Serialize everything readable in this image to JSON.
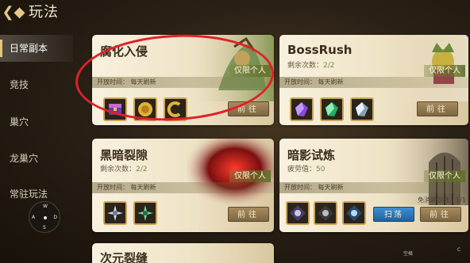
{
  "header": {
    "title": "玩法"
  },
  "sidebar": {
    "items": [
      {
        "label": "日常副本"
      },
      {
        "label": "竞技"
      },
      {
        "label": "巢穴"
      },
      {
        "label": "龙巢穴"
      },
      {
        "label": "常驻玩法"
      }
    ]
  },
  "compass": {
    "n": "W",
    "w": "A",
    "e": "D",
    "s": "S"
  },
  "cards": {
    "corruption": {
      "title": "腐化入侵",
      "time_label": "开放时间：",
      "time_value": "每天刷新",
      "personal": "仅限个人",
      "button": "前往"
    },
    "bossrush": {
      "title": "BossRush",
      "remaining_label": "剩余次数：",
      "remaining_value": "2/2",
      "time_label": "开放时间：",
      "time_value": "每天刷新",
      "personal": "仅限个人",
      "button": "前往"
    },
    "darkrift": {
      "title": "黑暗裂隙",
      "remaining_label": "剩余次数：",
      "remaining_value": "2/2",
      "time_label": "开放时间：",
      "time_value": "每天刷新",
      "personal": "仅限个人",
      "button": "前往"
    },
    "shadowtrial": {
      "title": "暗影试炼",
      "fatigue_label": "疲劳值：",
      "fatigue_value": "50",
      "time_label": "开放时间：",
      "time_value": "每天刷新",
      "personal": "仅限个人",
      "free_label": "免消耗次数：",
      "free_value": "1/1",
      "sweep": "扫荡",
      "button": "前往"
    },
    "dimension": {
      "title": "次元裂缝"
    }
  },
  "footer": {
    "tag1": "空格",
    "tag2": "C"
  },
  "colors": {
    "accent_gold": "#c9a35a",
    "highlight_red": "#e0202a",
    "sweep_blue": "#2a7fc8"
  }
}
